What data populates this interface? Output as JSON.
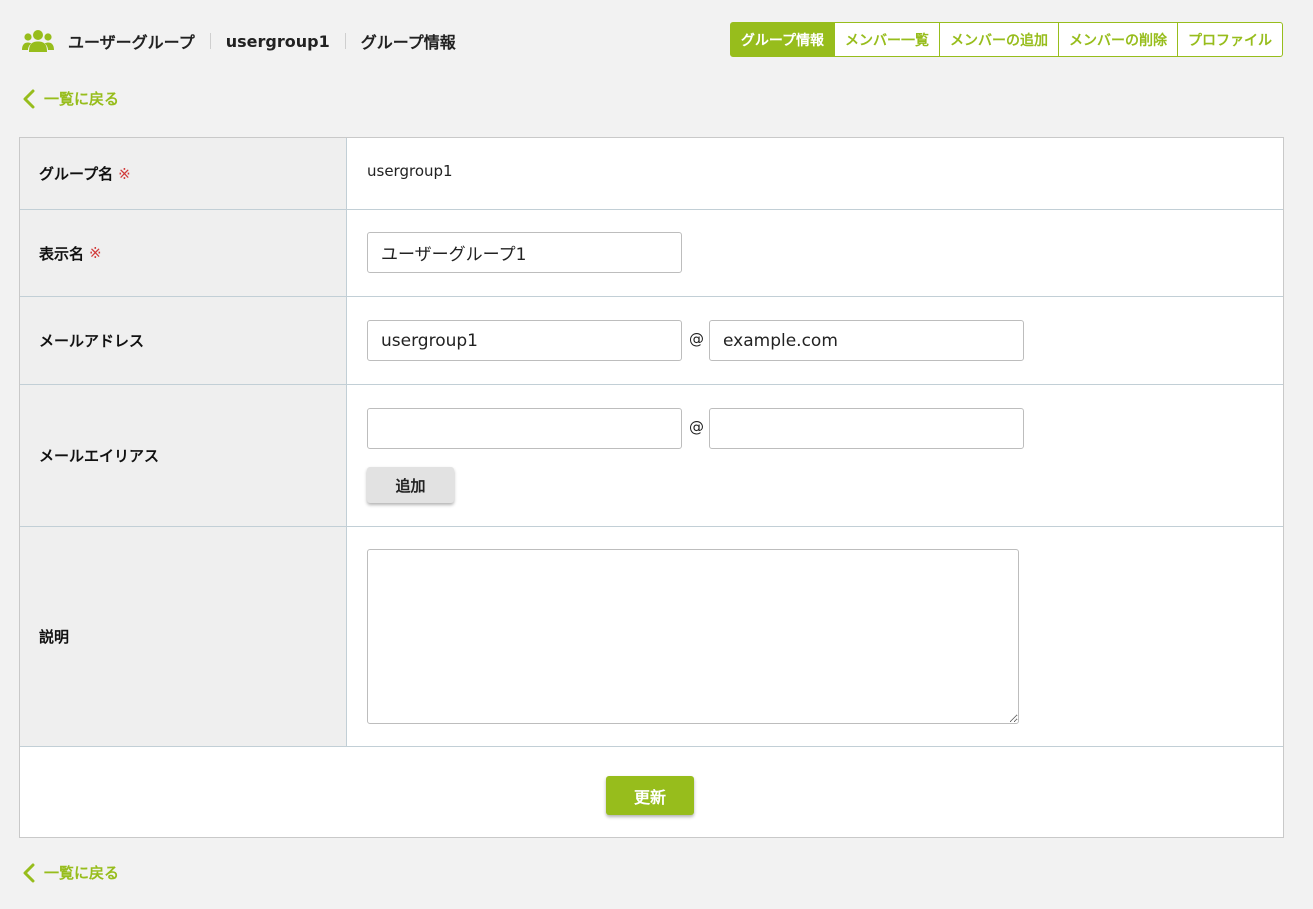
{
  "header": {
    "section": "ユーザーグループ",
    "group": "usergroup1",
    "page": "グループ情報"
  },
  "tabs": [
    {
      "label": "グループ情報",
      "active": true
    },
    {
      "label": "メンバー一覧",
      "active": false
    },
    {
      "label": "メンバーの追加",
      "active": false
    },
    {
      "label": "メンバーの削除",
      "active": false
    },
    {
      "label": "プロファイル",
      "active": false
    }
  ],
  "back_link": "一覧に戻る",
  "required_mark": "※",
  "form": {
    "group_name": {
      "label": "グループ名",
      "value": "usergroup1"
    },
    "display_name": {
      "label": "表示名",
      "value": "ユーザーグループ1"
    },
    "email": {
      "label": "メールアドレス",
      "local": "usergroup1",
      "at": "@",
      "domain": "example.com"
    },
    "alias": {
      "label": "メールエイリアス",
      "local": "",
      "at": "@",
      "domain": "",
      "add_button": "追加"
    },
    "description": {
      "label": "説明",
      "value": ""
    }
  },
  "update_button": "更新",
  "colors": {
    "accent": "#97bd1c",
    "required": "#d13a3a"
  }
}
